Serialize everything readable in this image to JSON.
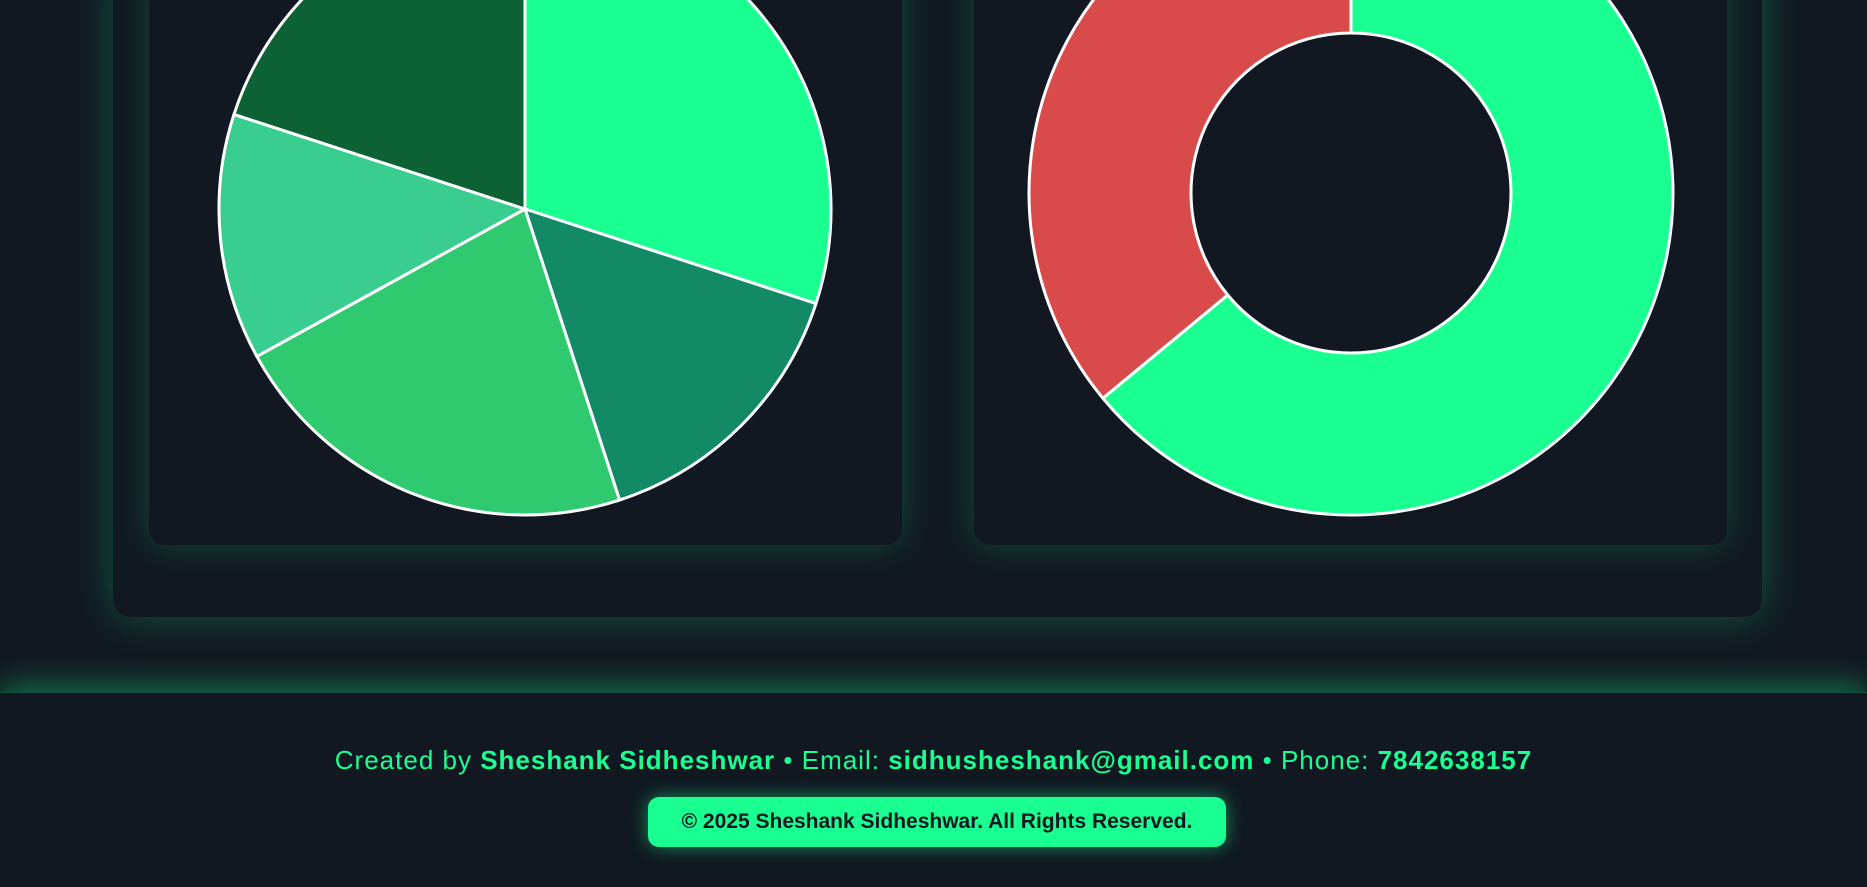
{
  "chart_data": [
    {
      "type": "pie",
      "values": [
        30,
        15,
        22,
        13,
        20
      ],
      "colors": [
        "#19ff92",
        "#138a66",
        "#2fca70",
        "#39cd8f",
        "#0c6235"
      ],
      "stroke": "#ffffff"
    },
    {
      "type": "donut",
      "values": [
        64,
        36
      ],
      "colors": [
        "#19ff92",
        "#d94b4b"
      ],
      "stroke": "#ffffff"
    }
  ],
  "footer": {
    "created_prefix": "Created by ",
    "author": "Sheshank Sidheshwar",
    "email_prefix": " • Email: ",
    "email": "sidhusheshank@gmail.com",
    "phone_prefix": " • Phone: ",
    "phone": "7842638157",
    "copyright": "© 2025 Sheshank Sidheshwar. All Rights Reserved."
  },
  "colors": {
    "background": "#111821",
    "accent": "#19ff92"
  }
}
